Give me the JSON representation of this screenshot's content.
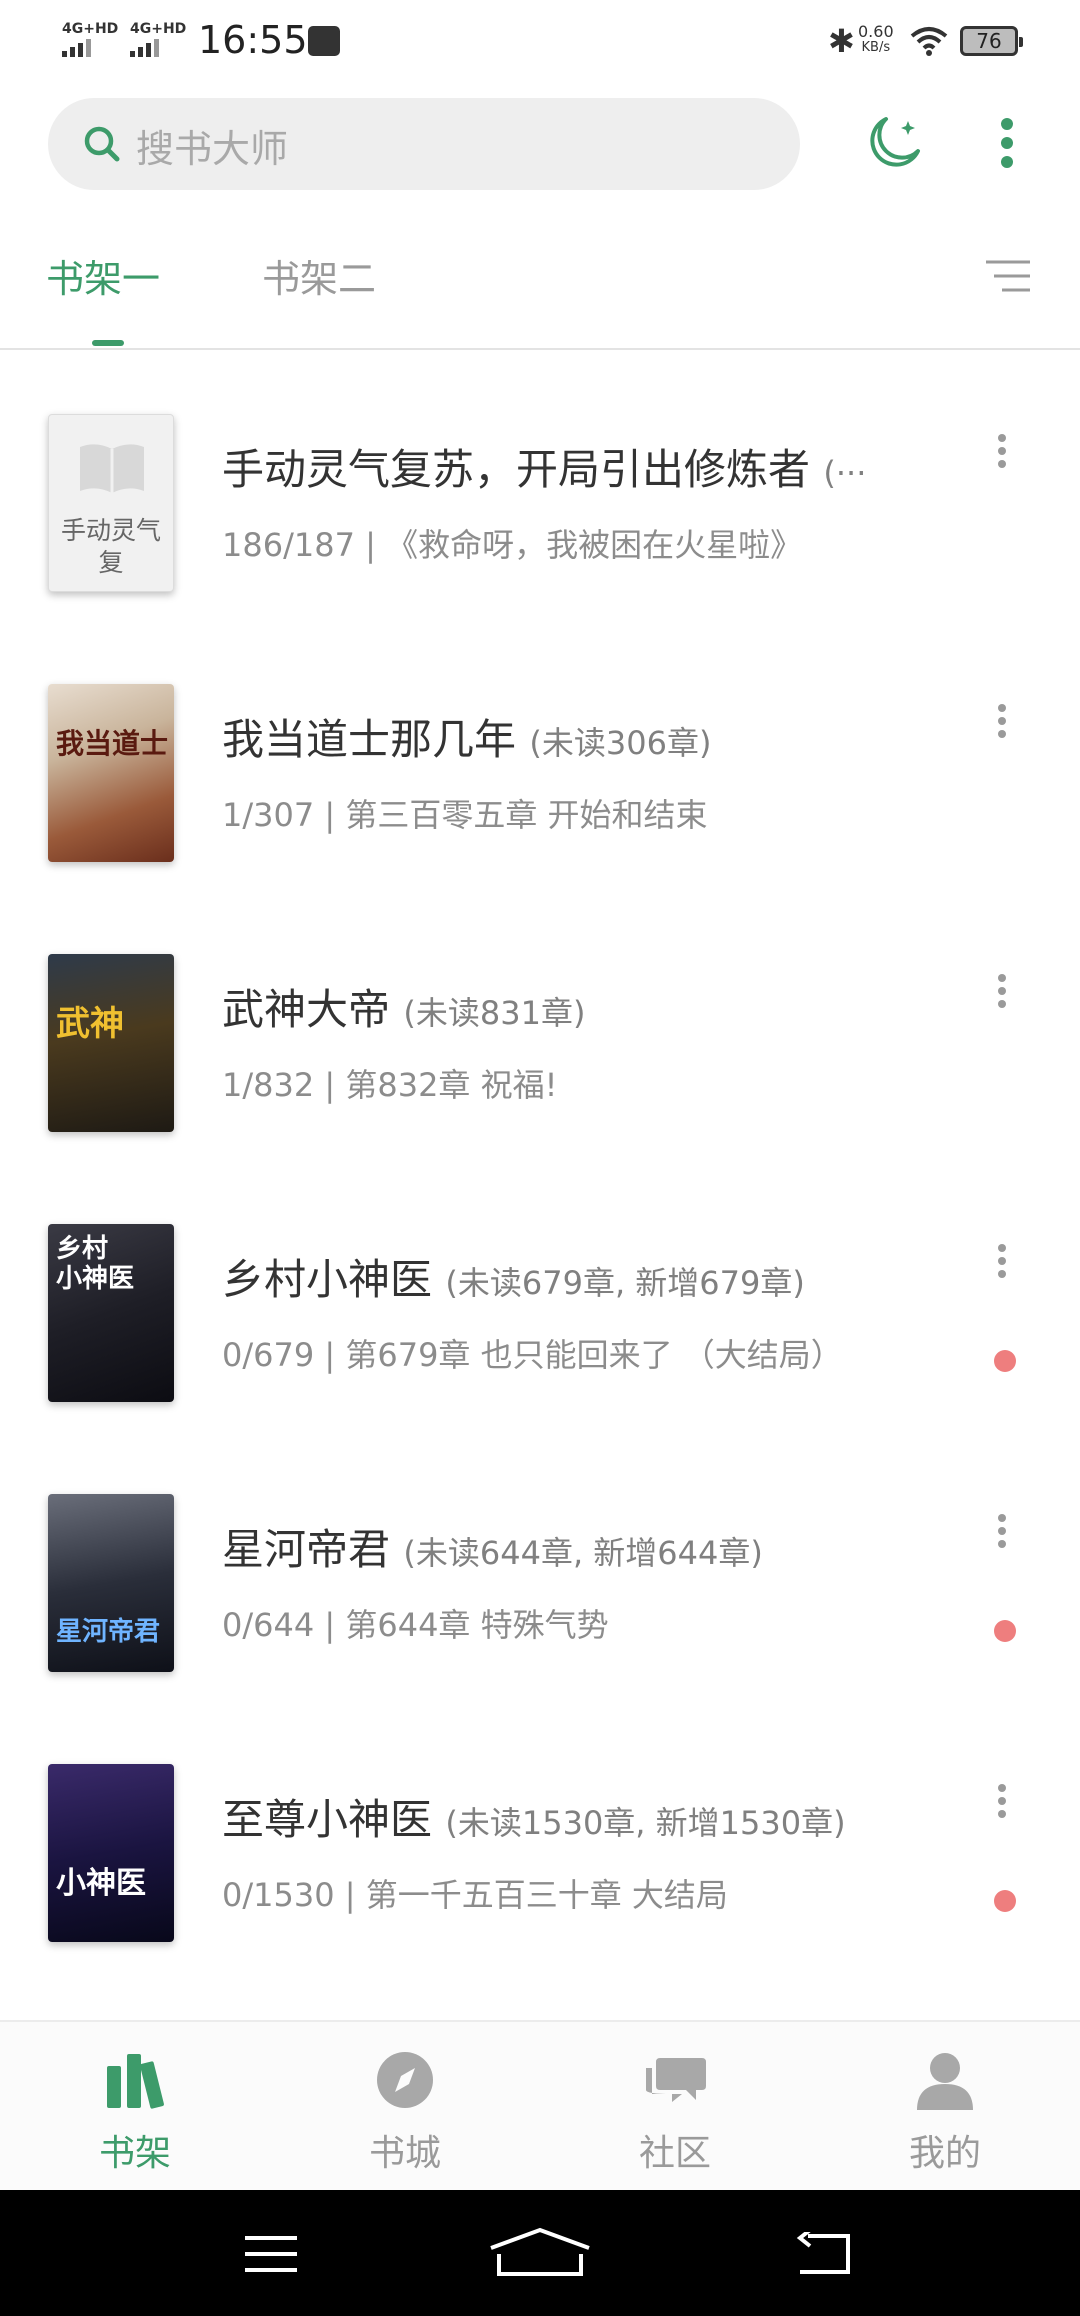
{
  "status_bar": {
    "sim1": "4G+HD",
    "sim2": "4G+HD",
    "time": "16:55",
    "net_speed_value": "0.60",
    "net_speed_unit": "KB/s",
    "battery": "76"
  },
  "header": {
    "search_placeholder": "搜书大师",
    "icons": [
      "search-icon",
      "night-mode-moon-icon",
      "more-vertical-icon"
    ]
  },
  "tabs": [
    {
      "label": "书架一",
      "active": true
    },
    {
      "label": "书架二",
      "active": false
    }
  ],
  "books": [
    {
      "title": "手动灵气复苏，开局引出修炼者",
      "unread": "(···",
      "progress": "186/187",
      "latest": "《救命呀，我被困在火星啦》",
      "cover_text": "手动灵气复",
      "has_update": false
    },
    {
      "title": "我当道士那几年",
      "unread": "(未读306章)",
      "progress": "1/307",
      "latest": "第三百零五章 开始和结束",
      "cover_text": "",
      "has_update": false
    },
    {
      "title": "武神大帝",
      "unread": "(未读831章)",
      "progress": "1/832",
      "latest": "第832章 祝福!",
      "cover_text": "",
      "has_update": false
    },
    {
      "title": "乡村小神医",
      "unread": "(未读679章, 新增679章)",
      "progress": "0/679",
      "latest": "第679章 也只能回来了 （大结局）",
      "cover_text": "",
      "has_update": true
    },
    {
      "title": "星河帝君",
      "unread": "(未读644章, 新增644章)",
      "progress": "0/644",
      "latest": "第644章 特殊气势",
      "cover_text": "",
      "has_update": true
    },
    {
      "title": "至尊小神医",
      "unread": "(未读1530章, 新增1530章)",
      "progress": "0/1530",
      "latest": "第一千五百三十章 大结局",
      "cover_text": "",
      "has_update": true
    }
  ],
  "bottom_nav": [
    {
      "label": "书架",
      "icon": "bookshelf-icon",
      "active": true
    },
    {
      "label": "书城",
      "icon": "compass-icon",
      "active": false
    },
    {
      "label": "社区",
      "icon": "chat-bubbles-icon",
      "active": false
    },
    {
      "label": "我的",
      "icon": "person-icon",
      "active": false
    }
  ],
  "colors": {
    "accent": "#3d9b6a",
    "update_dot": "#ee7e7e"
  }
}
